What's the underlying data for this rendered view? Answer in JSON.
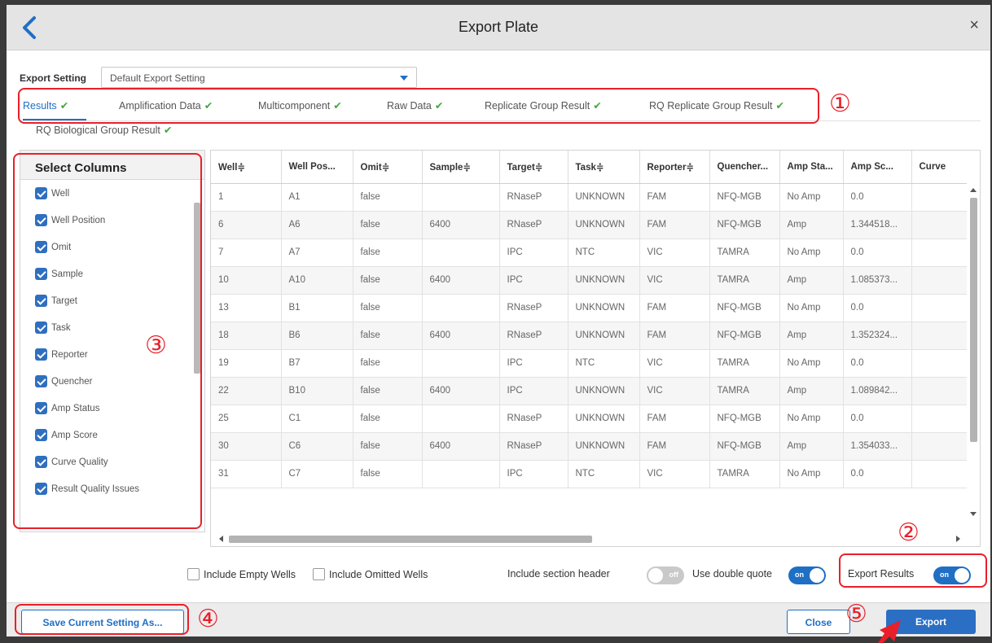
{
  "dialog": {
    "title": "Export Plate",
    "close_glyph": "×"
  },
  "export_setting": {
    "label": "Export Setting",
    "selected": "Default Export Setting"
  },
  "tabs": [
    {
      "label": "Results",
      "check": "✔"
    },
    {
      "label": "Amplification Data",
      "check": "✔"
    },
    {
      "label": "Multicomponent",
      "check": "✔"
    },
    {
      "label": "Raw Data",
      "check": "✔"
    },
    {
      "label": "Replicate Group Result",
      "check": "✔"
    },
    {
      "label": "RQ Replicate Group Result",
      "check": "✔"
    },
    {
      "label": "RQ Biological Group Result",
      "check": "✔"
    }
  ],
  "select_columns": {
    "title": "Select Columns",
    "items": [
      "Well",
      "Well Position",
      "Omit",
      "Sample",
      "Target",
      "Task",
      "Reporter",
      "Quencher",
      "Amp Status",
      "Amp Score",
      "Curve Quality",
      "Result Quality Issues"
    ]
  },
  "table": {
    "headers": [
      "Well≑",
      "Well Pos...",
      "Omit≑",
      "Sample≑",
      "Target≑",
      "Task≑",
      "Reporter≑",
      "Quencher...",
      "Amp Sta...",
      "Amp Sc...",
      "Curve"
    ],
    "rows": [
      [
        "1",
        "A1",
        "false",
        "",
        "RNaseP",
        "UNKNOWN",
        "FAM",
        "NFQ-MGB",
        "No Amp",
        "0.0",
        ""
      ],
      [
        "6",
        "A6",
        "false",
        "6400",
        "RNaseP",
        "UNKNOWN",
        "FAM",
        "NFQ-MGB",
        "Amp",
        "1.344518...",
        ""
      ],
      [
        "7",
        "A7",
        "false",
        "",
        "IPC",
        "NTC",
        "VIC",
        "TAMRA",
        "No Amp",
        "0.0",
        ""
      ],
      [
        "10",
        "A10",
        "false",
        "6400",
        "IPC",
        "UNKNOWN",
        "VIC",
        "TAMRA",
        "Amp",
        "1.085373...",
        ""
      ],
      [
        "13",
        "B1",
        "false",
        "",
        "RNaseP",
        "UNKNOWN",
        "FAM",
        "NFQ-MGB",
        "No Amp",
        "0.0",
        ""
      ],
      [
        "18",
        "B6",
        "false",
        "6400",
        "RNaseP",
        "UNKNOWN",
        "FAM",
        "NFQ-MGB",
        "Amp",
        "1.352324...",
        ""
      ],
      [
        "19",
        "B7",
        "false",
        "",
        "IPC",
        "NTC",
        "VIC",
        "TAMRA",
        "No Amp",
        "0.0",
        ""
      ],
      [
        "22",
        "B10",
        "false",
        "6400",
        "IPC",
        "UNKNOWN",
        "VIC",
        "TAMRA",
        "Amp",
        "1.089842...",
        ""
      ],
      [
        "25",
        "C1",
        "false",
        "",
        "RNaseP",
        "UNKNOWN",
        "FAM",
        "NFQ-MGB",
        "No Amp",
        "0.0",
        ""
      ],
      [
        "30",
        "C6",
        "false",
        "6400",
        "RNaseP",
        "UNKNOWN",
        "FAM",
        "NFQ-MGB",
        "Amp",
        "1.354033...",
        ""
      ],
      [
        "31",
        "C7",
        "false",
        "",
        "IPC",
        "NTC",
        "VIC",
        "TAMRA",
        "No Amp",
        "0.0",
        ""
      ]
    ]
  },
  "options": {
    "include_empty_wells": "Include Empty Wells",
    "include_omitted_wells": "Include Omitted Wells",
    "include_section_header": {
      "label": "Include section header",
      "state": "off"
    },
    "use_double_quote": {
      "label": "Use double quote",
      "state": "on"
    },
    "export_results": {
      "label": "Export Results",
      "state": "on"
    }
  },
  "footer": {
    "save_label": "Save Current Setting As...",
    "close_label": "Close",
    "export_label": "Export"
  },
  "annotations": [
    "①",
    "②",
    "③",
    "④",
    "⑤"
  ],
  "colors": {
    "accent": "#1f6fc5",
    "check_green": "#3fa93b",
    "annotation_red": "#e8202a"
  }
}
